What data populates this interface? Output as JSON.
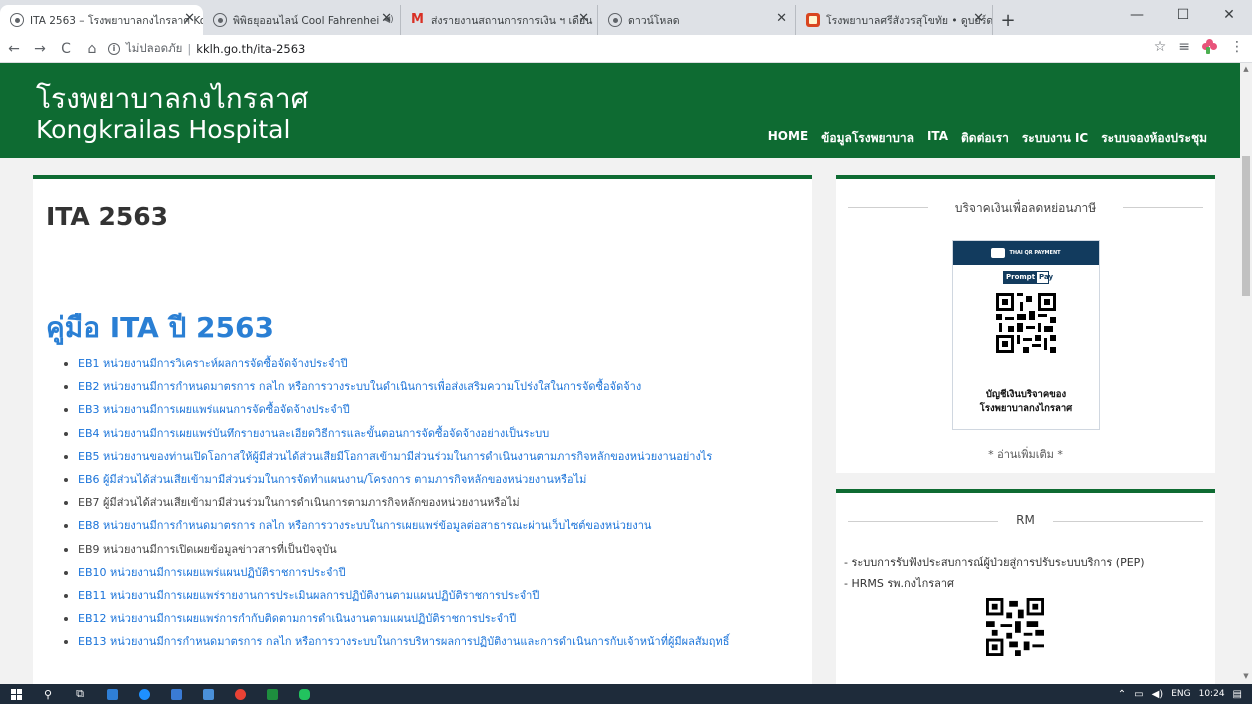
{
  "browser": {
    "tabs": [
      {
        "title": "ITA 2563 – โรงพยาบาลกงไกรลาศ Ko",
        "active": true
      },
      {
        "title": "พิพิธยุออนไลน์ Cool Fahrenhei",
        "active": false,
        "audio": true
      },
      {
        "title": "ส่งรายงานสถานการการเงิน ฯ เดือน",
        "active": false
      },
      {
        "title": "ดาวน์โหลด",
        "active": false
      },
      {
        "title": "โรงพยาบาลศรีสังวรสุโขทัย • ดูบอร์ด -",
        "active": false
      }
    ],
    "new_tab": "+",
    "window_controls": {
      "minimize": "—",
      "maximize": "☐",
      "close": "✕"
    },
    "address": {
      "security": "ไม่ปลอดภัย",
      "separator": "|",
      "url": "kklh.go.th/ita-2563"
    },
    "nav": {
      "back": "←",
      "forward": "→",
      "reload": "C",
      "home": "⌂"
    },
    "right_icons": {
      "star": "☆",
      "reading_list": "≡"
    }
  },
  "site": {
    "title_th": "โรงพยาบาลกงไกรลาศ",
    "title_en": "Kongkrailas Hospital",
    "nav": [
      "HOME",
      "ข้อมูลโรงพยาบาล",
      "ITA",
      "ติดต่อเรา",
      "ระบบงาน IC",
      "ระบบจองห้องประชุม"
    ]
  },
  "main": {
    "title": "ITA 2563",
    "manual_title": "คู่มือ ITA ปี 2563",
    "items": [
      {
        "text": "EB1  หน่วยงานมีการวิเคราะห์ผลการจัดซื้อจัดจ้างประจำปี",
        "link": true
      },
      {
        "text": "EB2 หน่วยงานมีการกำหนดมาตรการ กลไก หรือการวางระบบในดำเนินการเพื่อส่งเสริมความโปร่งใสในการจัดซื้อจัดจ้าง",
        "link": true
      },
      {
        "text": "EB3 หน่วยงานมีการเผยแพร่แผนการจัดซื้อจัดจ้างประจำปี",
        "link": true
      },
      {
        "text": "EB4 หน่วยงานมีการเผยแพร่บันทึกรายงานละเอียดวิธีการและขั้นตอนการจัดซื้อจัดจ้างอย่างเป็นระบบ",
        "link": true
      },
      {
        "text": "EB5 หน่วยงานของท่านเปิดโอกาสให้ผู้มีส่วนได้ส่วนเสียมีโอกาสเข้ามามีส่วนร่วมในการดำเนินงานตามภารกิจหลักของหน่วยงานอย่างไร",
        "link": true
      },
      {
        "text": "EB6 ผู้มีส่วนได้ส่วนเสียเข้ามามีส่วนร่วมในการจัดทำแผนงาน/โครงการ ตามภารกิจหลักของหน่วยงานหรือไม่",
        "link": true
      },
      {
        "text": "EB7  ผู้มีส่วนได้ส่วนเสียเข้ามามีส่วนร่วมในการดำเนินการตามภารกิจหลักของหน่วยงานหรือไม่",
        "link": false
      },
      {
        "text": "EB8 หน่วยงานมีการกำหนดมาตรการ กลไก หรือการวางระบบในการเผยแพร่ข้อมูลต่อสาธารณะผ่านเว็บไซต์ของหน่วยงาน",
        "link": true
      },
      {
        "text": "EB9 หน่วยงานมีการเปิดเผยข้อมูลข่าวสารที่เป็นปัจจุบัน",
        "link": false
      },
      {
        "text": "EB10 หน่วยงานมีการเผยแพร่แผนปฏิบัติราชการประจำปี",
        "link": true
      },
      {
        "text": "EB11 หน่วยงานมีการเผยแพร่รายงานการประเมินผลการปฏิบัติงานตามแผนปฏิบัติราชการประจำปี",
        "link": true
      },
      {
        "text": "EB12 หน่วยงานมีการเผยแพร่การกำกับติดตามการดำเนินงานตามแผนปฏิบัติราชการประจำปี",
        "link": true
      },
      {
        "text": "EB13 หน่วยงานมีการกำหนดมาตรการ กลไก หรือการวางระบบในการบริหารผลการปฏิบัติงานและการดำเนินการกับเจ้าหน้าที่ผู้มีผลสัมฤทธิ์",
        "link": true
      }
    ]
  },
  "sidebar": {
    "donation": {
      "heading": "บริจาคเงินเพื่อลดหย่อนภาษี",
      "qr_header": "THAI QR PAYMENT",
      "promptpay_left": "Prompt",
      "promptpay_right": "Pay",
      "caption_line1": "บัญชีเงินบริจาคของ",
      "caption_line2": "โรงพยาบาลกงไกรลาศ",
      "read_more": "* อ่านเพิ่มเติม *"
    },
    "rm": {
      "heading": "RM",
      "links": [
        "- ระบบการรับฟังประสบการณ์ผู้ป่วยสู่การปรับระบบบริการ (PEP)",
        "- HRMS รพ.กงไกรลาศ"
      ]
    }
  },
  "taskbar": {
    "tray": {
      "lang": "ENG",
      "time": "10:24"
    }
  },
  "colors": {
    "brand_green": "#0e6b32",
    "link_blue": "#1a73d9",
    "heading_blue": "#2a7fd4",
    "taskbar": "#1e2b3a"
  }
}
